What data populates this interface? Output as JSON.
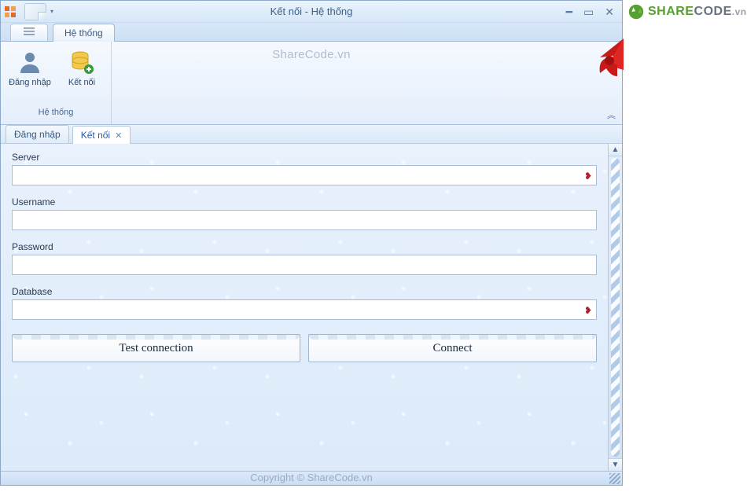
{
  "titlebar": {
    "title": "Kết nối - Hệ thống"
  },
  "ribbon": {
    "tab_label": "Hệ thống",
    "group_label": "Hệ thống",
    "login_label": "Đăng nhập",
    "connect_label": "Kết nối"
  },
  "doc_tabs": {
    "login": "Đăng nhập",
    "connect": "Kết nối"
  },
  "form": {
    "server_label": "Server",
    "server_value": "",
    "username_label": "Username",
    "username_value": "",
    "password_label": "Password",
    "password_value": "",
    "database_label": "Database",
    "database_value": ""
  },
  "buttons": {
    "test": "Test connection",
    "connect": "Connect"
  },
  "watermarks": {
    "top": "ShareCode.vn",
    "footer": "Copyright © ShareCode.vn"
  },
  "brand": {
    "share": "SHARE",
    "code": "CODE",
    "tld": ".vn"
  }
}
